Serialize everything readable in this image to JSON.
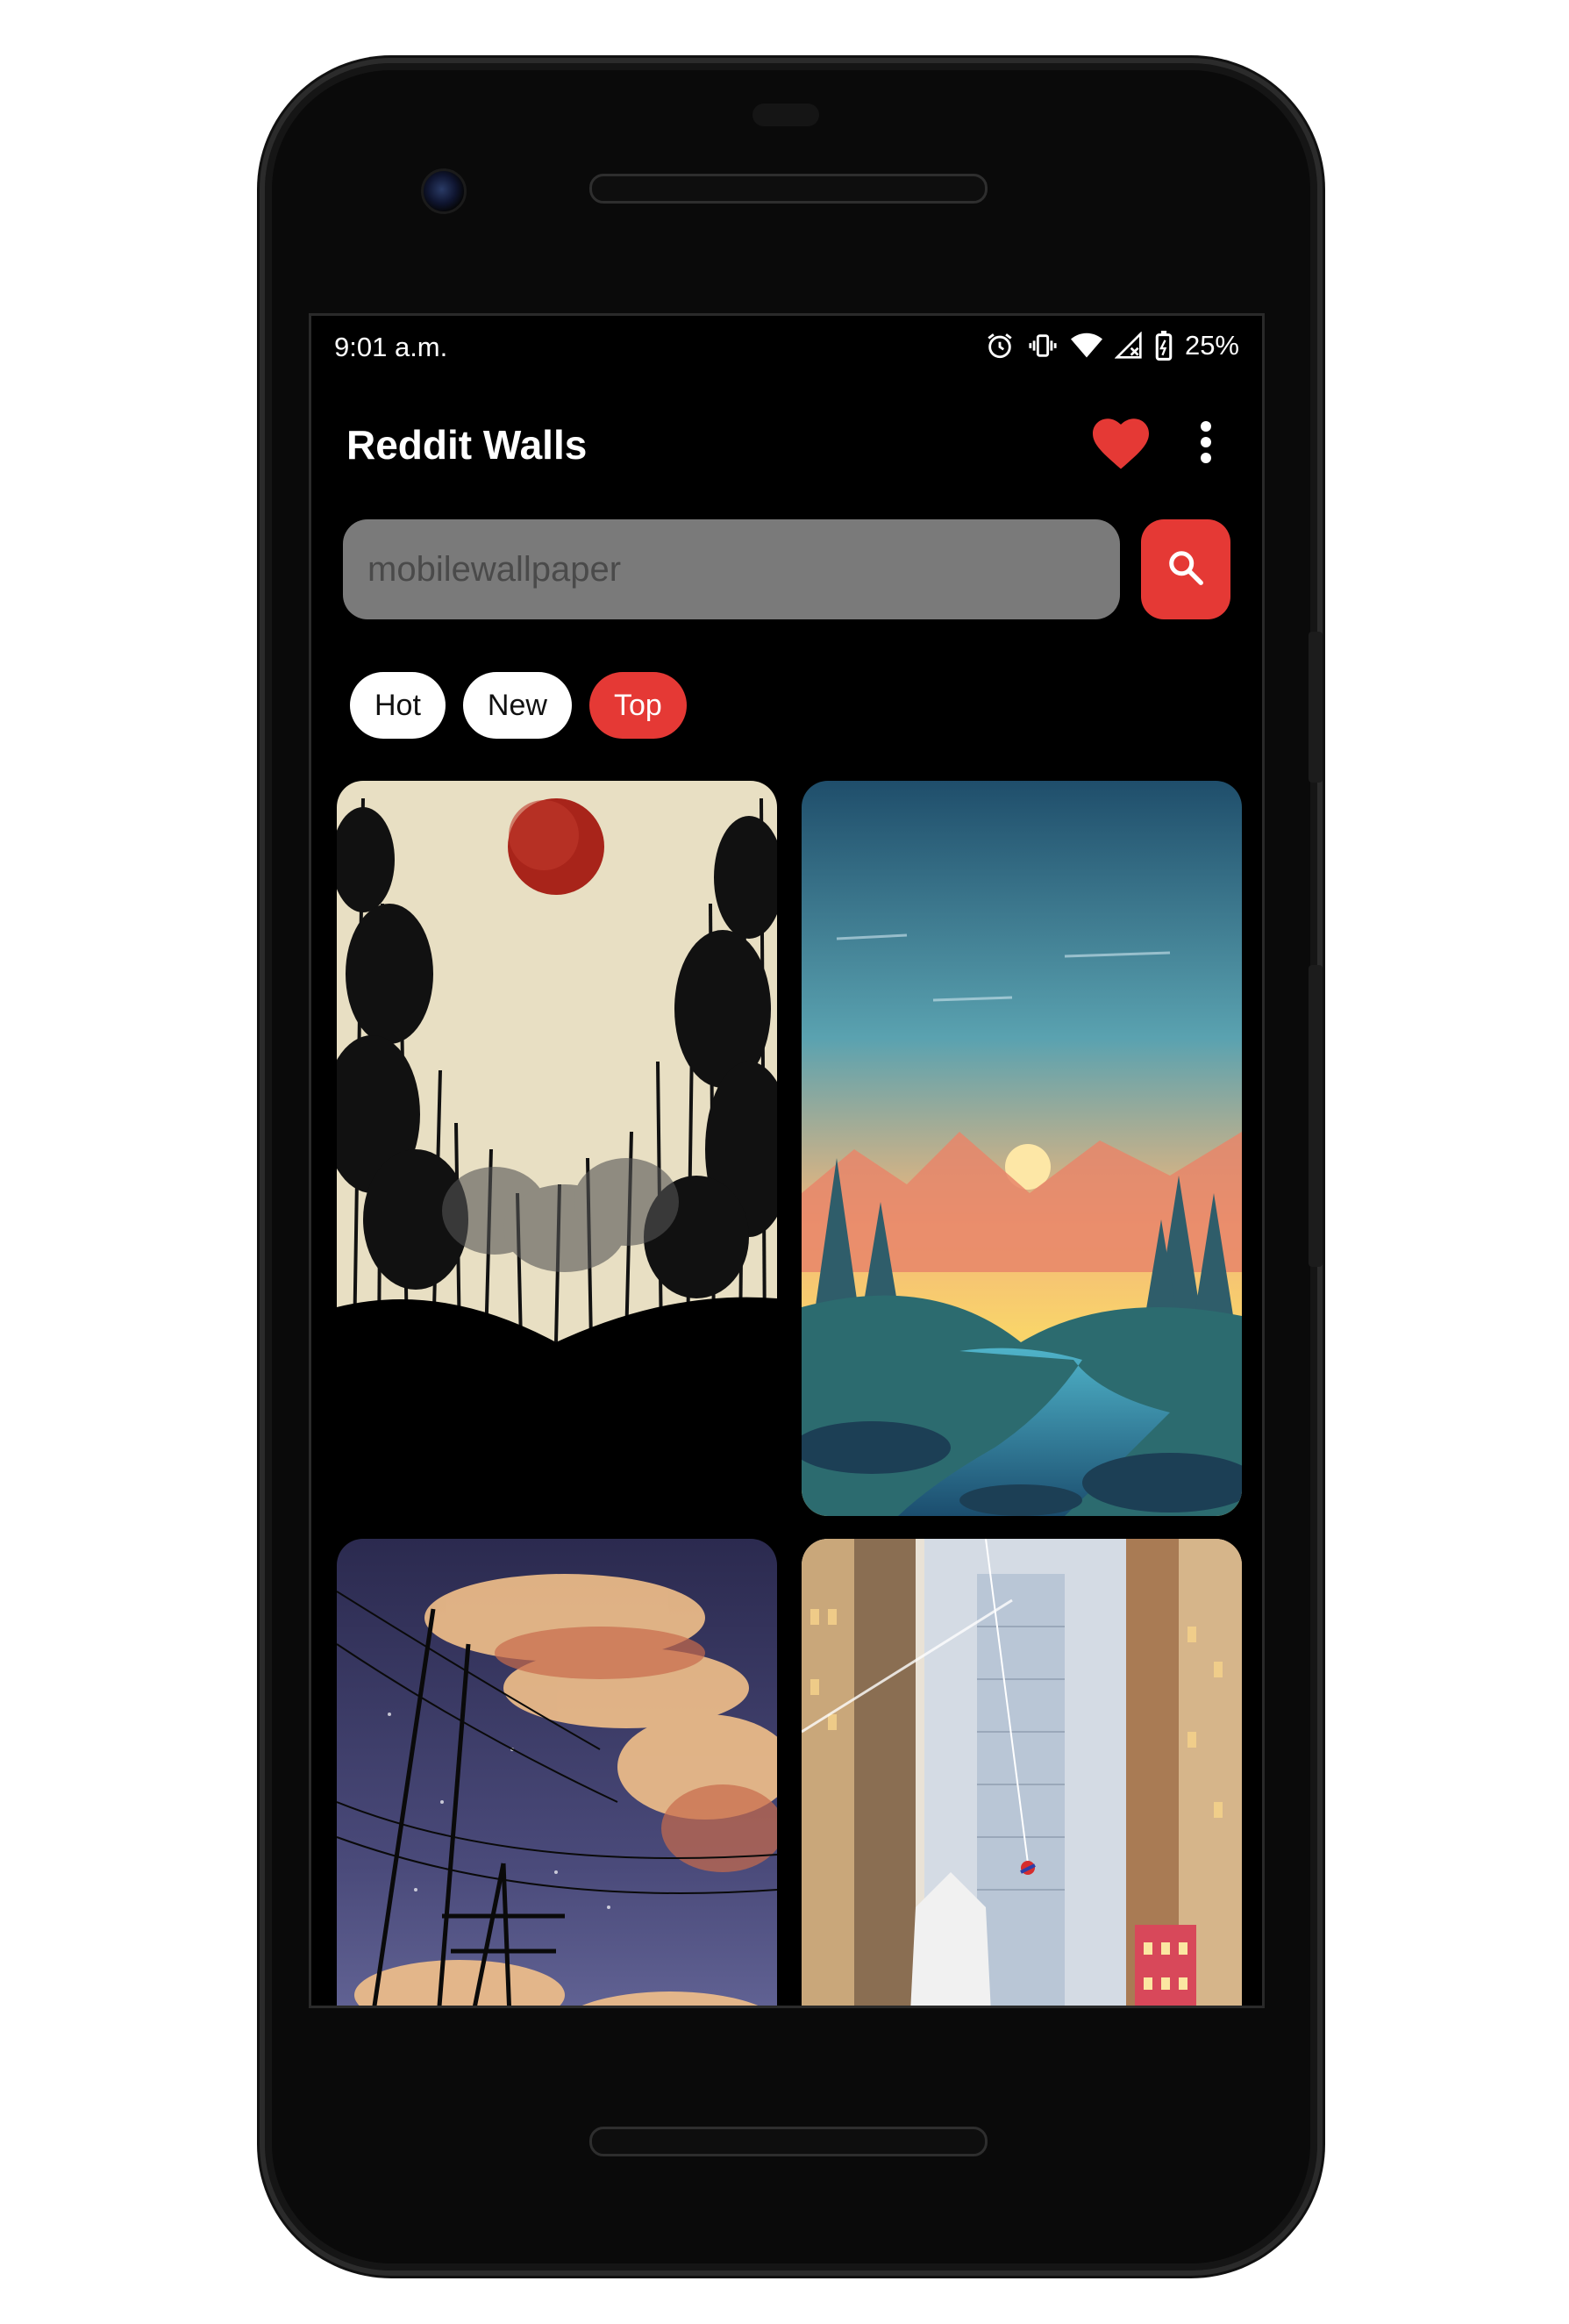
{
  "status_bar": {
    "time": "9:01 a.m.",
    "battery_percent": "25%",
    "icons": [
      "alarm-icon",
      "vibrate-icon",
      "wifi-icon",
      "signal-icon",
      "battery-icon"
    ]
  },
  "app_bar": {
    "title": "Reddit Walls",
    "favorite_icon": "heart-icon",
    "menu_icon": "more-vert-icon"
  },
  "search": {
    "value": "mobilewallpaper",
    "button_icon": "search-icon"
  },
  "sort_tabs": [
    {
      "label": "Hot",
      "active": false
    },
    {
      "label": "New",
      "active": false
    },
    {
      "label": "Top",
      "active": true
    }
  ],
  "wallpapers": [
    {
      "description": "bamboo-silhouette-red-moon"
    },
    {
      "description": "forest-river-sunset"
    },
    {
      "description": "clouds-power-lines-night"
    },
    {
      "description": "city-skyscrapers-spider-hero"
    }
  ],
  "colors": {
    "accent": "#e53935",
    "background": "#000000",
    "search_fill": "#7a7a7a"
  }
}
